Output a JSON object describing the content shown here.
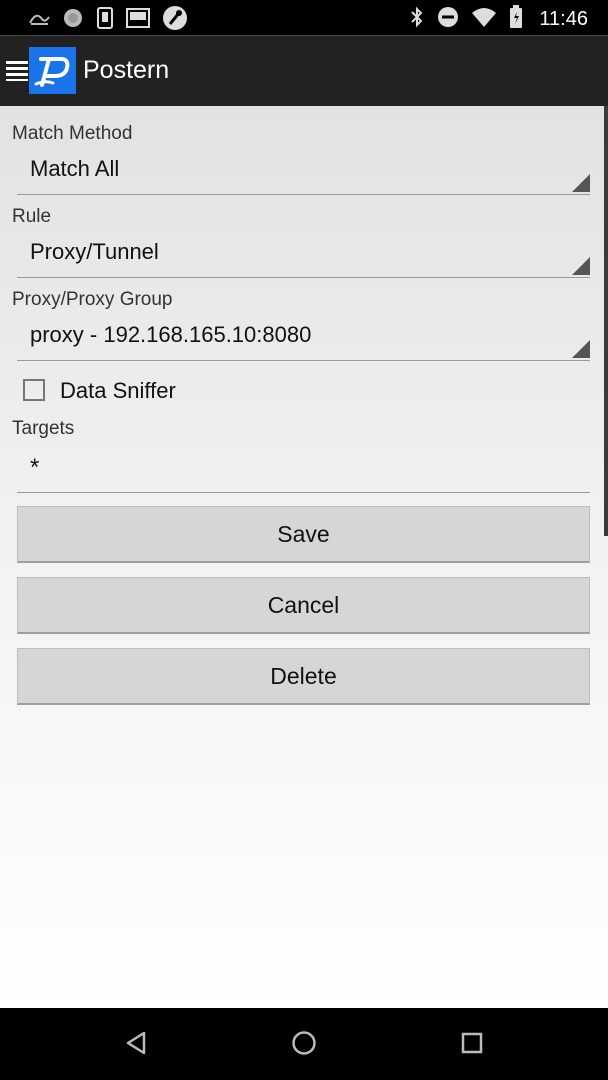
{
  "status_bar": {
    "time": "11:46",
    "left_icons": [
      "app-notification-icon",
      "record-icon",
      "sim-icon",
      "terminal-icon",
      "wrench-icon"
    ],
    "right_icons": [
      "bluetooth-icon",
      "do-not-disturb-icon",
      "wifi-icon",
      "battery-icon"
    ]
  },
  "action_bar": {
    "title": "Postern",
    "logo_letter": "P"
  },
  "form": {
    "match_method": {
      "label": "Match Method",
      "value": "Match All"
    },
    "rule": {
      "label": "Rule",
      "value": "Proxy/Tunnel"
    },
    "proxy_group": {
      "label": "Proxy/Proxy Group",
      "value": "proxy - 192.168.165.10:8080"
    },
    "data_sniffer": {
      "label": "Data Sniffer",
      "checked": false
    },
    "targets": {
      "label": "Targets",
      "value": "*"
    }
  },
  "buttons": {
    "save": "Save",
    "cancel": "Cancel",
    "delete": "Delete"
  },
  "nav_bar": {
    "icons": [
      "back-icon",
      "home-icon",
      "recents-icon"
    ]
  }
}
